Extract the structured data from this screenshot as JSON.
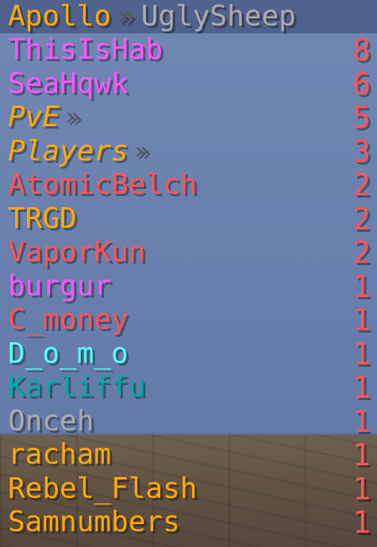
{
  "colors": {
    "gold": "#ffaa00",
    "light_purple": "#ff55ff",
    "red": "#ff5555",
    "aqua": "#55ffff",
    "dark_aqua": "#00aaaa",
    "gray": "#aaaaaa",
    "dark_gray": "#555555"
  },
  "scoreboard": {
    "title": {
      "left": "Apollo",
      "separator": "»",
      "right": "UglySheep",
      "left_color": "#ffaa00",
      "separator_color": "#555555",
      "right_color": "#aaaaaa"
    },
    "rows": [
      {
        "name": "ThisIsHab",
        "score": "8",
        "color": "#ff55ff",
        "italic": false,
        "arrow": ""
      },
      {
        "name": "SeaHqwk",
        "score": "6",
        "color": "#ff55ff",
        "italic": false,
        "arrow": ""
      },
      {
        "name": "PvE",
        "score": "5",
        "color": "#ffaa00",
        "italic": true,
        "arrow": "»"
      },
      {
        "name": "Players",
        "score": "3",
        "color": "#ffaa00",
        "italic": true,
        "arrow": "»"
      },
      {
        "name": "AtomicBelch",
        "score": "2",
        "color": "#ff5555",
        "italic": false,
        "arrow": ""
      },
      {
        "name": "TRGD",
        "score": "2",
        "color": "#ffaa00",
        "italic": false,
        "arrow": ""
      },
      {
        "name": "VaporKun",
        "score": "2",
        "color": "#ff5555",
        "italic": false,
        "arrow": ""
      },
      {
        "name": "burgur",
        "score": "1",
        "color": "#ff55ff",
        "italic": false,
        "arrow": ""
      },
      {
        "name": "C_money",
        "score": "1",
        "color": "#ff5555",
        "italic": false,
        "arrow": ""
      },
      {
        "name": "D_o_m_o",
        "score": "1",
        "color": "#55ffff",
        "italic": false,
        "arrow": ""
      },
      {
        "name": "Karliffu",
        "score": "1",
        "color": "#00aaaa",
        "italic": false,
        "arrow": ""
      },
      {
        "name": "Onceh",
        "score": "1",
        "color": "#aaaaaa",
        "italic": false,
        "arrow": ""
      },
      {
        "name": "racham",
        "score": "1",
        "color": "#ffaa00",
        "italic": false,
        "arrow": ""
      },
      {
        "name": "Rebel_Flash",
        "score": "1",
        "color": "#ffaa00",
        "italic": false,
        "arrow": ""
      },
      {
        "name": "Samnumbers",
        "score": "1",
        "color": "#ffaa00",
        "italic": false,
        "arrow": ""
      }
    ],
    "score_color": "#ff5555"
  }
}
